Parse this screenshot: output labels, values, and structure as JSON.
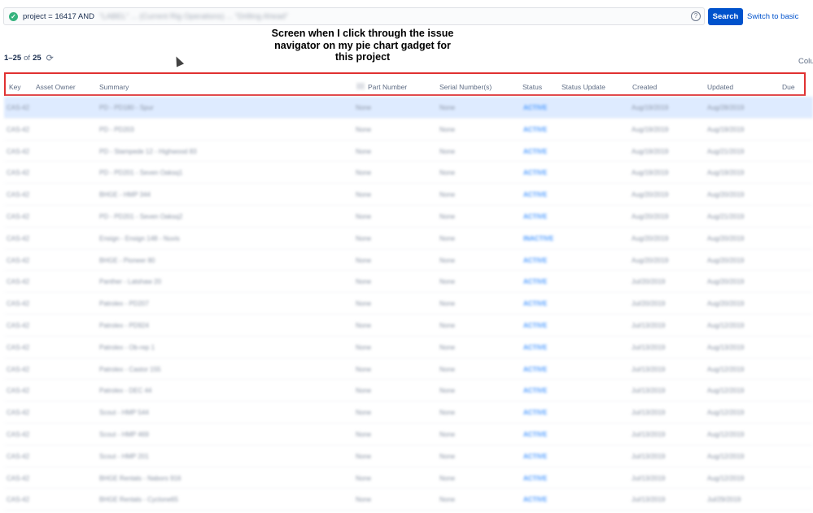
{
  "search": {
    "query_prefix": "project = 16417 AND",
    "query_rest": "\"LABEL\" ... (Current Rig Operations) ... \"Drilling Ahead\"",
    "button": "Search",
    "switch": "Switch to basic"
  },
  "annotation": {
    "line1": "Screen when I click through the issue",
    "line2": "navigator on my pie chart gadget for",
    "line3": "this project"
  },
  "results": {
    "range": "1–25",
    "of": "of",
    "total": "25"
  },
  "columns_label": "Colu",
  "headers": {
    "key": "Key",
    "owner": "Asset Owner",
    "summary": "Summary",
    "part": "Part Number",
    "serial": "Serial Number(s)",
    "status": "Status",
    "status_update": "Status Update",
    "created": "Created",
    "updated": "Updated",
    "due": "Due"
  },
  "rows": [
    {
      "key": "CAS-42",
      "summary": "PD - PD180 - Spur",
      "part": "None",
      "serial": "None",
      "status": "ACTIVE",
      "created": "Aug/19/2019",
      "updated": "Aug/28/2019"
    },
    {
      "key": "CAS-42",
      "summary": "PD - PD203",
      "part": "None",
      "serial": "None",
      "status": "ACTIVE",
      "created": "Aug/19/2019",
      "updated": "Aug/19/2019"
    },
    {
      "key": "CAS-42",
      "summary": "PD - Stampede 12 - Highwood 83",
      "part": "None",
      "serial": "None",
      "status": "ACTIVE",
      "created": "Aug/19/2019",
      "updated": "Aug/21/2019"
    },
    {
      "key": "CAS-42",
      "summary": "PD - PD201 - Seven Oaksq1",
      "part": "None",
      "serial": "None",
      "status": "ACTIVE",
      "created": "Aug/19/2019",
      "updated": "Aug/19/2019"
    },
    {
      "key": "CAS-42",
      "summary": "BHGE - HMP 344",
      "part": "None",
      "serial": "None",
      "status": "ACTIVE",
      "created": "Aug/20/2019",
      "updated": "Aug/20/2019"
    },
    {
      "key": "CAS-42",
      "summary": "PD - PD201 - Seven Oaksq2",
      "part": "None",
      "serial": "None",
      "status": "ACTIVE",
      "created": "Aug/20/2019",
      "updated": "Aug/21/2019"
    },
    {
      "key": "CAS-42",
      "summary": "Ensign - Ensign 148 - Nuvis",
      "part": "None",
      "serial": "None",
      "status": "INACTIVE",
      "created": "Aug/20/2019",
      "updated": "Aug/20/2019"
    },
    {
      "key": "CAS-42",
      "summary": "BHGE - Pioneer 80",
      "part": "None",
      "serial": "None",
      "status": "ACTIVE",
      "created": "Aug/20/2019",
      "updated": "Aug/20/2019"
    },
    {
      "key": "CAS-42",
      "summary": "Panther - Latshaw 20",
      "part": "None",
      "serial": "None",
      "status": "ACTIVE",
      "created": "Jul/20/2019",
      "updated": "Aug/20/2019"
    },
    {
      "key": "CAS-42",
      "summary": "Patrolex - PD207",
      "part": "None",
      "serial": "None",
      "status": "ACTIVE",
      "created": "Jul/20/2019",
      "updated": "Aug/20/2019"
    },
    {
      "key": "CAS-42",
      "summary": "Patrolex - PD924",
      "part": "None",
      "serial": "None",
      "status": "ACTIVE",
      "created": "Jul/13/2019",
      "updated": "Aug/12/2019"
    },
    {
      "key": "CAS-42",
      "summary": "Patrolex - Ob-rep 1",
      "part": "None",
      "serial": "None",
      "status": "ACTIVE",
      "created": "Jul/13/2019",
      "updated": "Aug/13/2019"
    },
    {
      "key": "CAS-42",
      "summary": "Patrolex - Castor 155",
      "part": "None",
      "serial": "None",
      "status": "ACTIVE",
      "created": "Jul/13/2019",
      "updated": "Aug/12/2019"
    },
    {
      "key": "CAS-42",
      "summary": "Patrolex - DEC 44",
      "part": "None",
      "serial": "None",
      "status": "ACTIVE",
      "created": "Jul/13/2019",
      "updated": "Aug/12/2019"
    },
    {
      "key": "CAS-42",
      "summary": "Scout - HMP 544",
      "part": "None",
      "serial": "None",
      "status": "ACTIVE",
      "created": "Jul/13/2019",
      "updated": "Aug/12/2019"
    },
    {
      "key": "CAS-42",
      "summary": "Scout - HMP 469",
      "part": "None",
      "serial": "None",
      "status": "ACTIVE",
      "created": "Jul/13/2019",
      "updated": "Aug/12/2019"
    },
    {
      "key": "CAS-42",
      "summary": "Scout - HMP 201",
      "part": "None",
      "serial": "None",
      "status": "ACTIVE",
      "created": "Jul/13/2019",
      "updated": "Aug/12/2019"
    },
    {
      "key": "CAS-42",
      "summary": "BHGE Rentals - Nabors 916",
      "part": "None",
      "serial": "None",
      "status": "ACTIVE",
      "created": "Jul/13/2019",
      "updated": "Aug/12/2019"
    },
    {
      "key": "CAS-42",
      "summary": "BHGE Rentals - Cyclone65",
      "part": "None",
      "serial": "None",
      "status": "ACTIVE",
      "created": "Jul/13/2019",
      "updated": "Jul/29/2019"
    }
  ]
}
